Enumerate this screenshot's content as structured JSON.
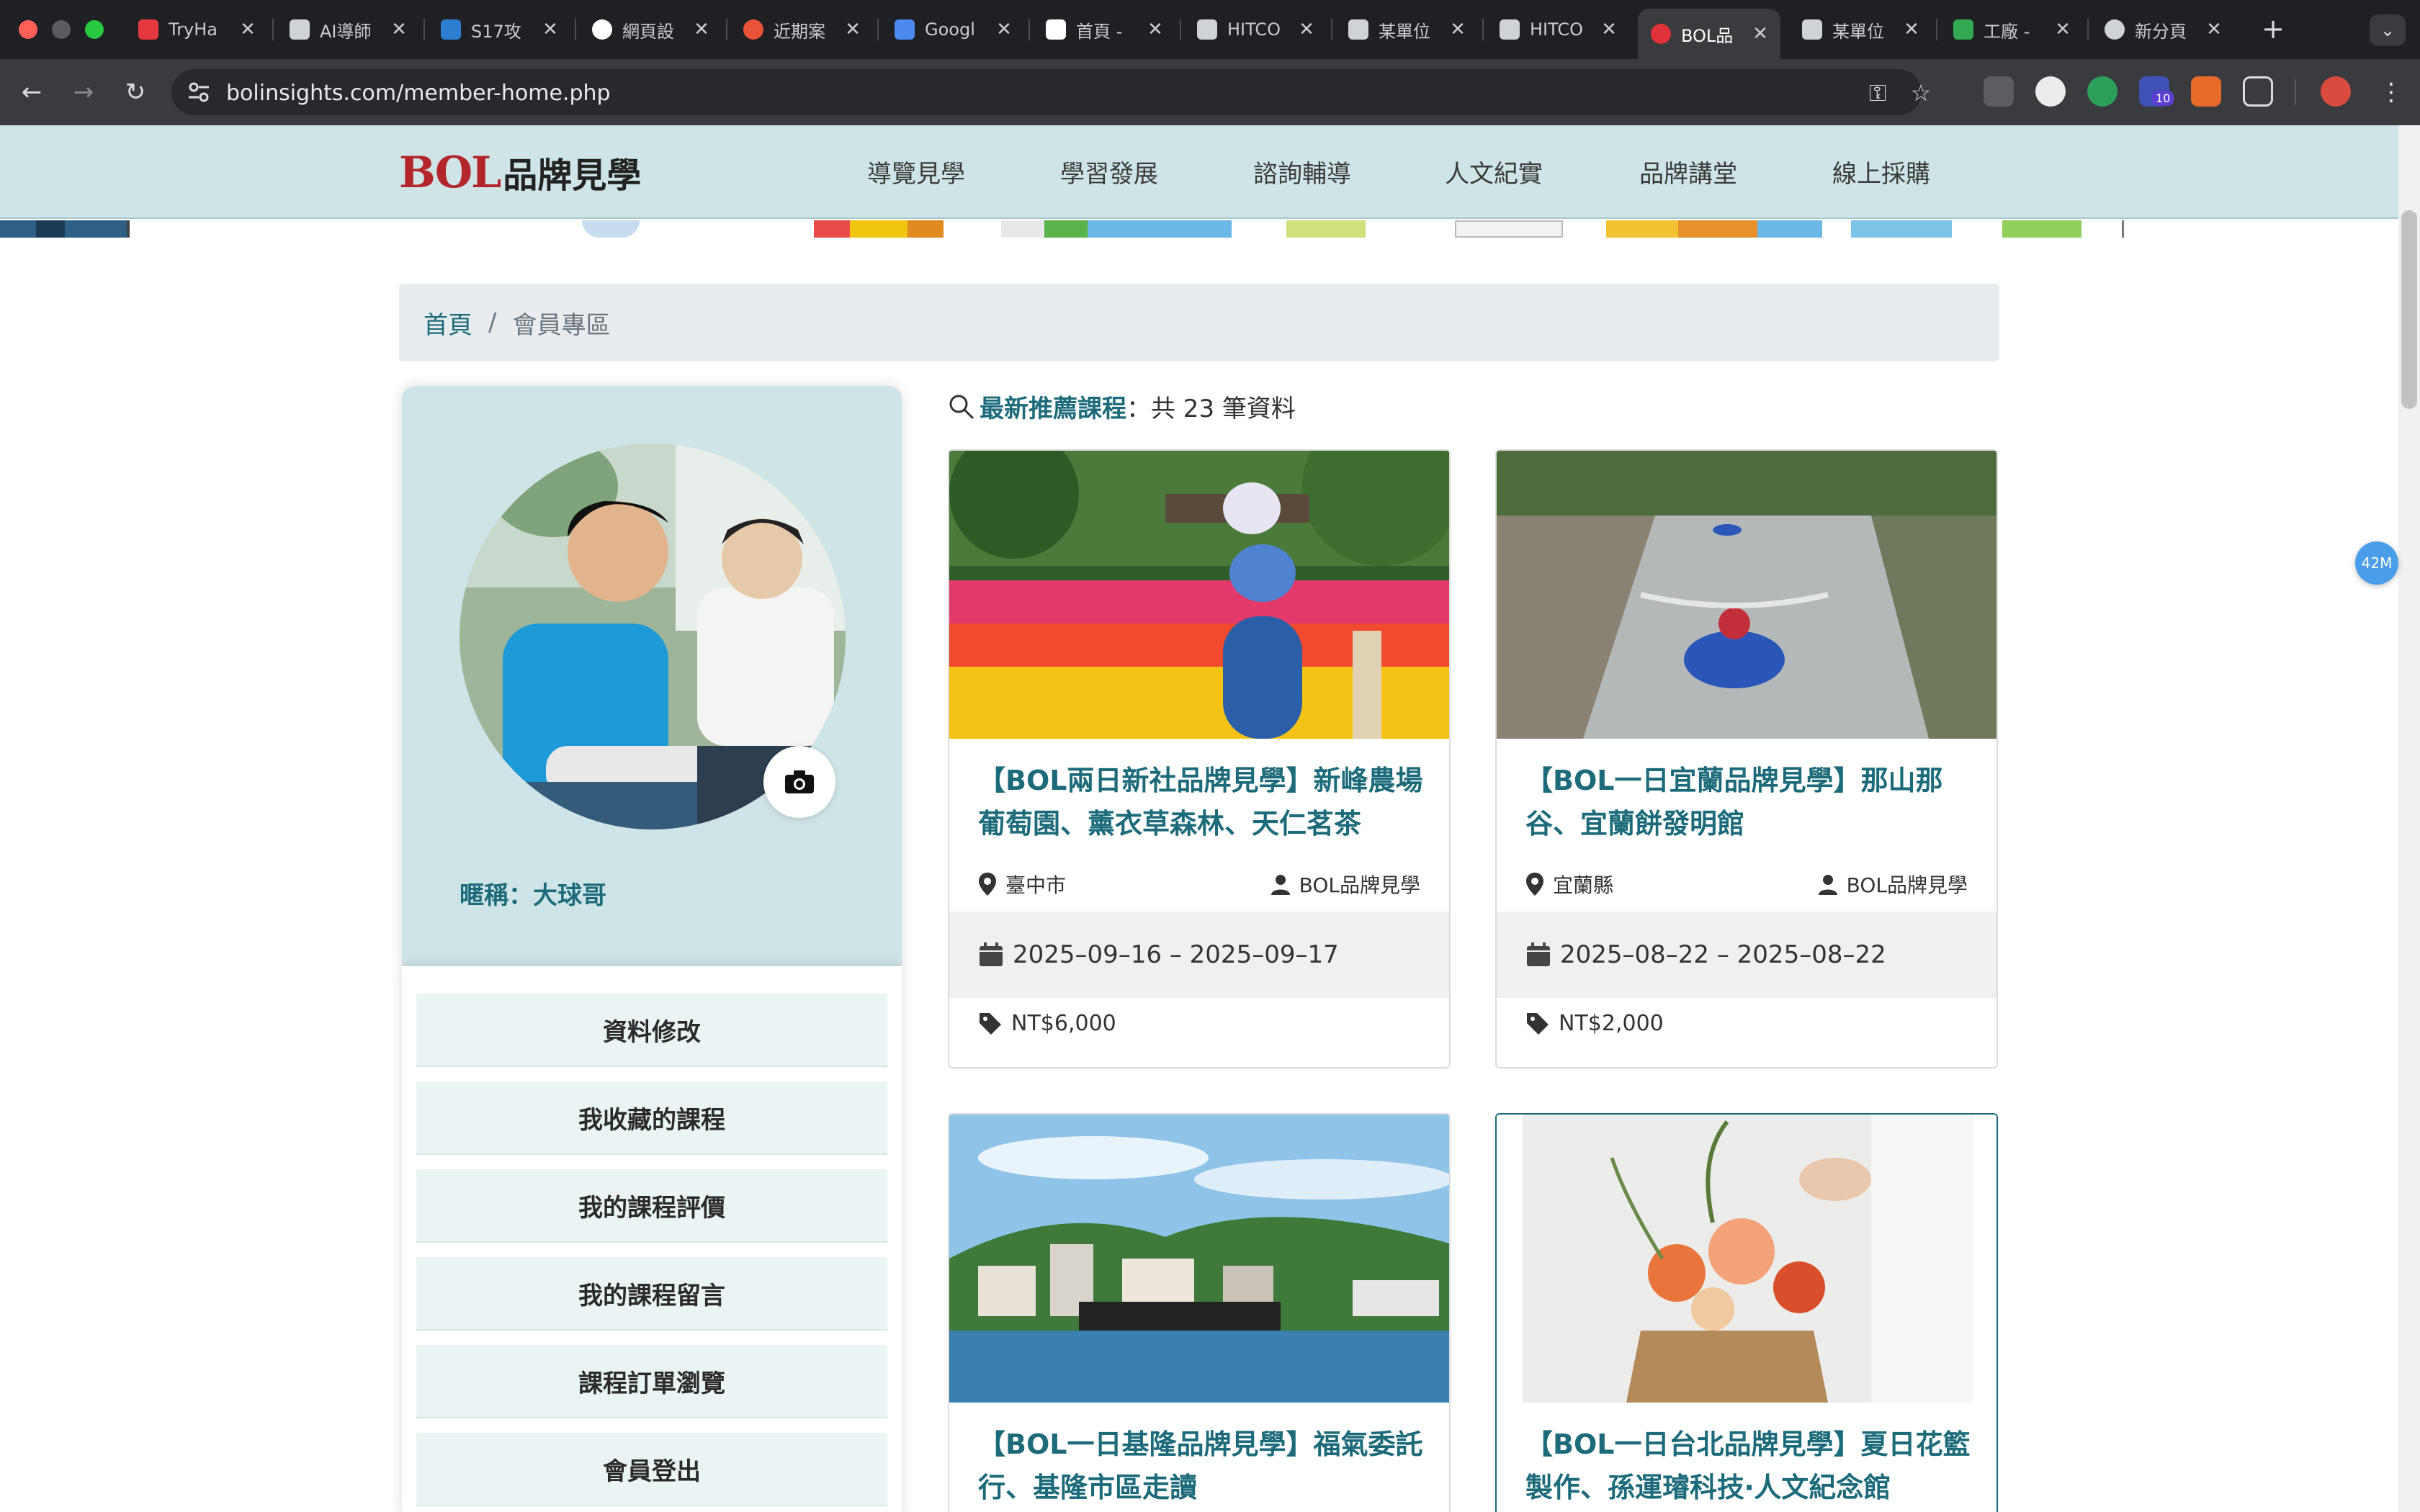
{
  "browser": {
    "tabs": [
      {
        "title": "TryHa",
        "favicon": "cloud-icon",
        "color": "#e5393f"
      },
      {
        "title": "AI導師",
        "favicon": "ai-spark-icon",
        "color": "#cfd3d8"
      },
      {
        "title": "S17攻",
        "favicon": "cube-icon",
        "color": "#2e7fd1"
      },
      {
        "title": "網頁設",
        "favicon": "google-icon",
        "color": "#ffffff"
      },
      {
        "title": "近期案",
        "favicon": "pink-circle-icon",
        "color": "#e8533a"
      },
      {
        "title": "Googl",
        "favicon": "gemini-icon",
        "color": "#4d8af0"
      },
      {
        "title": "首頁 -",
        "favicon": "threads-icon",
        "color": "#ffffff"
      },
      {
        "title": "HITCO",
        "favicon": "hitcon-icon",
        "color": "#cfd3d8"
      },
      {
        "title": "某單位",
        "favicon": "hitcon-icon",
        "color": "#cfd3d8"
      },
      {
        "title": "HITCO",
        "favicon": "hitcon-icon",
        "color": "#cfd3d8"
      },
      {
        "title": "BOL品",
        "favicon": "bol-icon",
        "color": "#e0323a"
      },
      {
        "title": "某單位",
        "favicon": "hitcon-icon",
        "color": "#cfd3d8"
      },
      {
        "title": "工廠 -",
        "favicon": "maps-pin-icon",
        "color": "#34a853"
      },
      {
        "title": "新分頁",
        "favicon": "chrome-icon",
        "color": "#cfd3d8"
      }
    ],
    "active_tab_index": 10,
    "url": "bolinsights.com/member-home.php",
    "extension_badge": "10",
    "new_tab_symbol": "+",
    "close_symbol": "✕"
  },
  "site": {
    "logo_latin": "BOL",
    "logo_chinese": "品牌見學",
    "nav": [
      "導覽見學",
      "學習發展",
      "諮詢輔導",
      "人文紀實",
      "品牌講堂",
      "線上採購"
    ]
  },
  "breadcrumb": {
    "home": "首頁",
    "separator": "/",
    "current": "會員專區"
  },
  "profile": {
    "nickname": "暱稱：大球哥"
  },
  "member_menu": [
    "資料修改",
    "我收藏的課程",
    "我的課程評價",
    "我的課程留言",
    "課程訂單瀏覽",
    "會員登出"
  ],
  "courses": {
    "heading": "最新推薦課程",
    "count_text": "：共 23 筆資料",
    "items": [
      {
        "title": "【BOL兩日新社品牌見學】新峰農場葡萄園、薰衣草森林、天仁茗茶",
        "location": "臺中市",
        "organizer": "BOL品牌見學",
        "dates": "2025–09–16 – 2025–09–17",
        "price": "NT$6,000"
      },
      {
        "title": "【BOL一日宜蘭品牌見學】那山那谷、宜蘭餅發明館",
        "location": "宜蘭縣",
        "organizer": "BOL品牌見學",
        "dates": "2025–08–22 – 2025–08–22",
        "price": "NT$2,000"
      },
      {
        "title": "【BOL一日基隆品牌見學】福氣委託行、基隆市區走讀",
        "location": "",
        "organizer": "",
        "dates": "",
        "price": ""
      },
      {
        "title": "【BOL一日台北品牌見學】夏日花籃製作、孫運璿科技‧人文紀念館",
        "location": "",
        "organizer": "",
        "dates": "",
        "price": ""
      }
    ]
  },
  "floating_badge": "42M",
  "colors": {
    "accent": "#1d6b7a",
    "header_bg": "#cfe4e6",
    "logo_red": "#b3262b",
    "menu_bg": "#eaf4f4",
    "chrome_dark": "#1f2023"
  }
}
